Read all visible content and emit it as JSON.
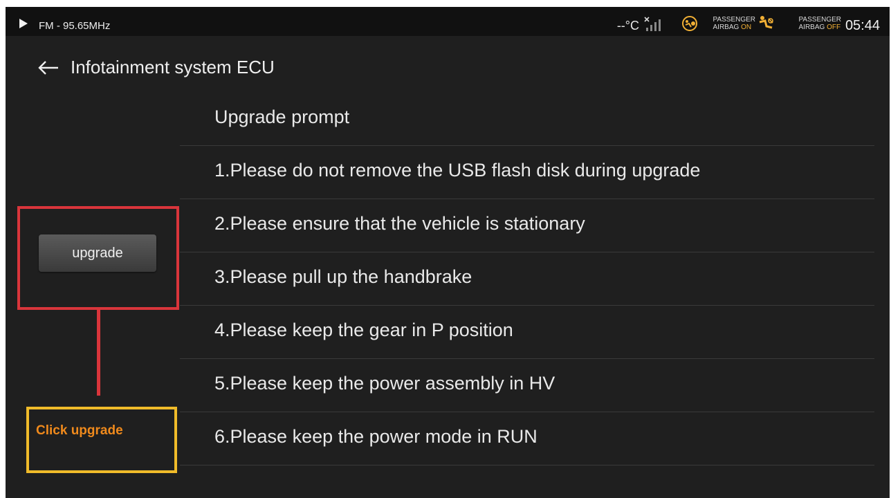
{
  "status_bar": {
    "radio": "FM - 95.65MHz",
    "temperature": "--°C",
    "airbag_on": {
      "line1": "PASSENGER",
      "line2_prefix": "AIRBAG",
      "line2_state": "ON"
    },
    "airbag_off": {
      "line1": "PASSENGER",
      "line2_prefix": "AIRBAG",
      "line2_state": "OFF"
    },
    "time": "05:44"
  },
  "header": {
    "title": "Infotainment system ECU"
  },
  "prompt": {
    "items": [
      "Upgrade prompt",
      "1.Please do not remove the USB flash disk during upgrade",
      "2.Please ensure that the vehicle is stationary",
      "3.Please pull up the handbrake",
      "4.Please keep the gear in P position",
      "5.Please keep the power assembly in HV",
      "6.Please keep the power mode in RUN"
    ]
  },
  "upgrade_button": {
    "label": "upgrade"
  },
  "annotation": {
    "text": "Click upgrade"
  },
  "colors": {
    "background": "#1f1f1f",
    "highlight_red": "#d9353b",
    "highlight_yellow": "#f0bb2a",
    "callout_text": "#f08a1c",
    "airbag_state": "#f2b035"
  }
}
